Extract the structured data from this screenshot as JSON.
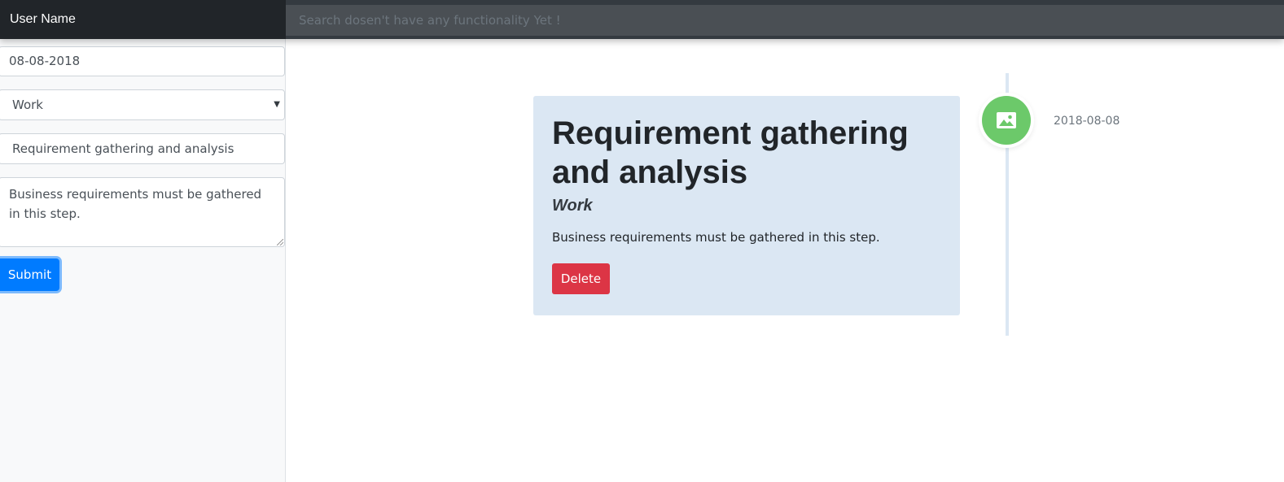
{
  "header": {
    "brand": "User Name",
    "search_placeholder": "Search dosen't have any functionality Yet !"
  },
  "form": {
    "date_value": "08-08-2018",
    "category_value": "Work",
    "title_value": "Requirement gathering and analysis",
    "description_value": "Business requirements must be gathered in this step.",
    "submit_label": "Submit"
  },
  "timeline": {
    "entries": [
      {
        "title": "Requirement gathering and analysis",
        "category": "Work",
        "description": "Business requirements must be gathered in this step.",
        "delete_label": "Delete",
        "date": "2018-08-08",
        "icon": "image-icon",
        "icon_color": "#6cc96a"
      }
    ]
  },
  "colors": {
    "navbar": "#343a40",
    "brand_bg": "#212529",
    "primary": "#007bff",
    "danger": "#dc3545",
    "card_bg": "#dbe7f3"
  }
}
